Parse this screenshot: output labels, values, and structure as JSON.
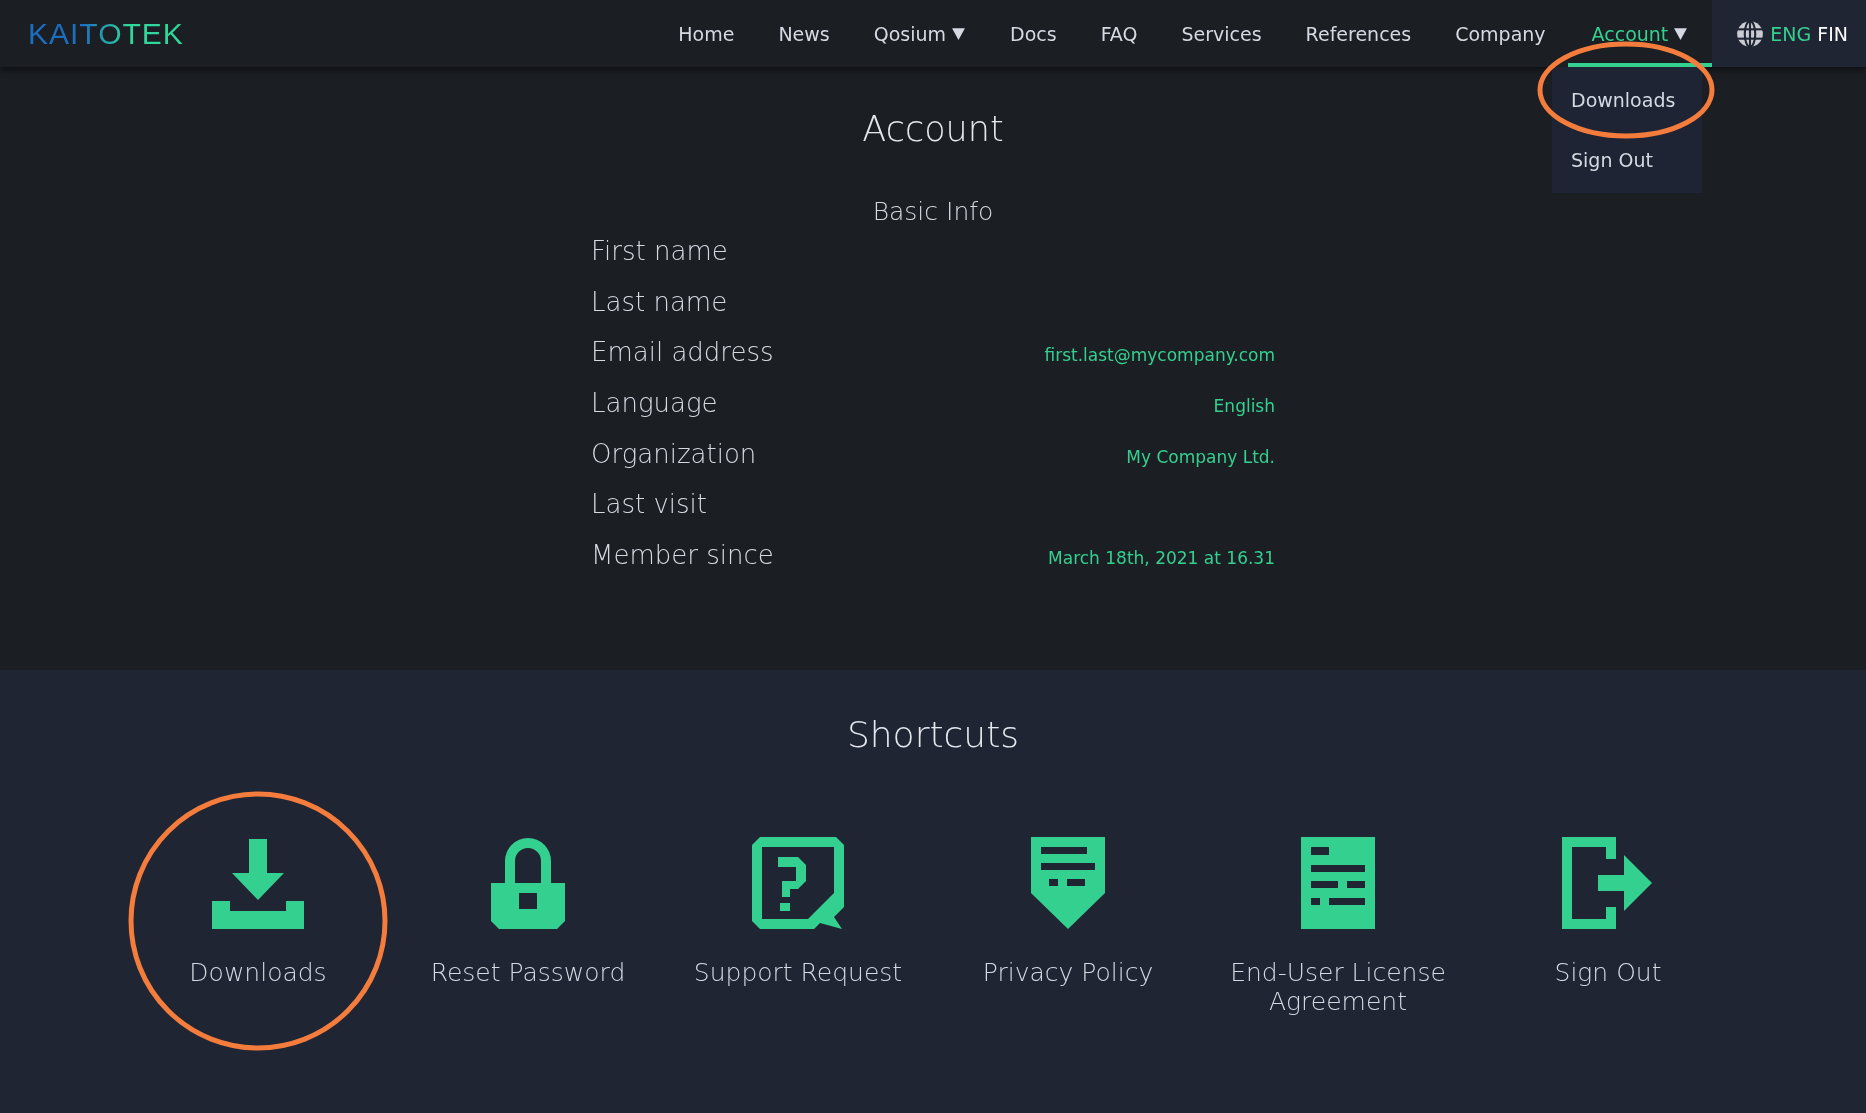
{
  "logo": "KAITOTEK",
  "nav": [
    {
      "label": "Home",
      "selected": false,
      "has_caret": false
    },
    {
      "label": "News",
      "selected": false,
      "has_caret": false
    },
    {
      "label": "Qosium",
      "selected": false,
      "has_caret": true
    },
    {
      "label": "Docs",
      "selected": false,
      "has_caret": false
    },
    {
      "label": "FAQ",
      "selected": false,
      "has_caret": false
    },
    {
      "label": "Services",
      "selected": false,
      "has_caret": false
    },
    {
      "label": "References",
      "selected": false,
      "has_caret": false
    },
    {
      "label": "Company",
      "selected": false,
      "has_caret": false
    },
    {
      "label": "Account",
      "selected": true,
      "has_caret": true
    }
  ],
  "languages": [
    {
      "label": "ENG",
      "selected": true
    },
    {
      "label": "FIN",
      "selected": false
    }
  ],
  "dropdown": [
    "Downloads",
    "Sign Out"
  ],
  "title": "Account",
  "section_title": "Basic Info",
  "fields": [
    {
      "label": "First name"
    },
    {
      "label": "Last name"
    },
    {
      "label": "Email address",
      "value": "first.last@mycompany.com"
    },
    {
      "label": "Language",
      "value": "English"
    },
    {
      "label": "Organization",
      "value": "My Company Ltd."
    },
    {
      "label": "Last visit"
    },
    {
      "label": "Member since",
      "value": "March 18th, 2021 at 16.31"
    }
  ],
  "shortcuts_title": "Shortcuts",
  "shortcuts": [
    {
      "kind": "download",
      "label": "Downloads"
    },
    {
      "kind": "lock",
      "label": "Reset Password"
    },
    {
      "kind": "support",
      "label": "Support Request"
    },
    {
      "kind": "shield",
      "label": "Privacy Policy"
    },
    {
      "kind": "document",
      "label": "End-User License Agreement"
    },
    {
      "kind": "signout",
      "label": "Sign Out"
    }
  ]
}
